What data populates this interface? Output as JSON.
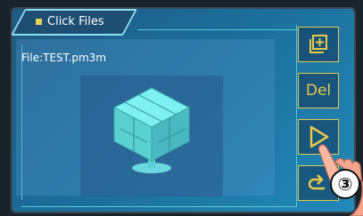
{
  "header": {
    "title": "Click Files"
  },
  "file": {
    "label": "File:TEST.pm3m"
  },
  "side_buttons": {
    "new_icon": "copy-plus-icon",
    "delete_label": "Del",
    "play_icon": "play-icon",
    "back_icon": "back-arrow-icon"
  },
  "annotation": {
    "step_label": "③"
  },
  "colors": {
    "accent": "#e6c94a",
    "screen_background": "#1c6d9a",
    "title_dot": "#e8d35a",
    "model": "#6fe6e6"
  }
}
